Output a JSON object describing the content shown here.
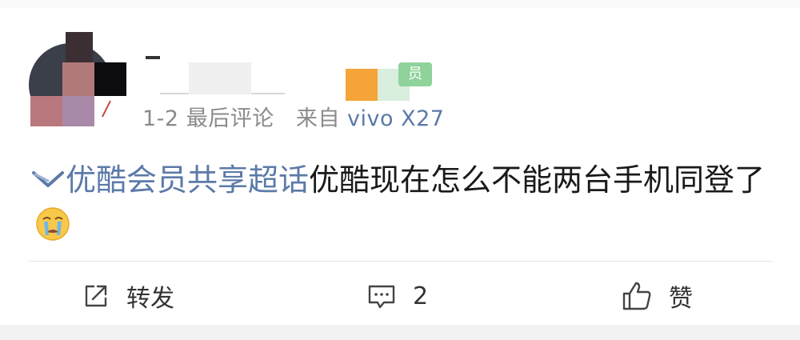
{
  "post": {
    "username": "",
    "meta": {
      "date": "1-2",
      "label": "最后评论",
      "source_prefix": "来自",
      "source": "vivo X27"
    },
    "topic": "优酷会员共享超话",
    "text": "优酷现在怎么不能两台手机同登了",
    "emoji": "crying-face-icon",
    "verified_badge": "员"
  },
  "actions": {
    "repost_label": "转发",
    "comment_count": "2",
    "like_label": "赞"
  },
  "colors": {
    "link": "#5b7aa8",
    "meta": "#8a8a8a",
    "text": "#1a1a1a",
    "badge_green": "#7cc68a",
    "badge_orange": "#f5a43a"
  }
}
